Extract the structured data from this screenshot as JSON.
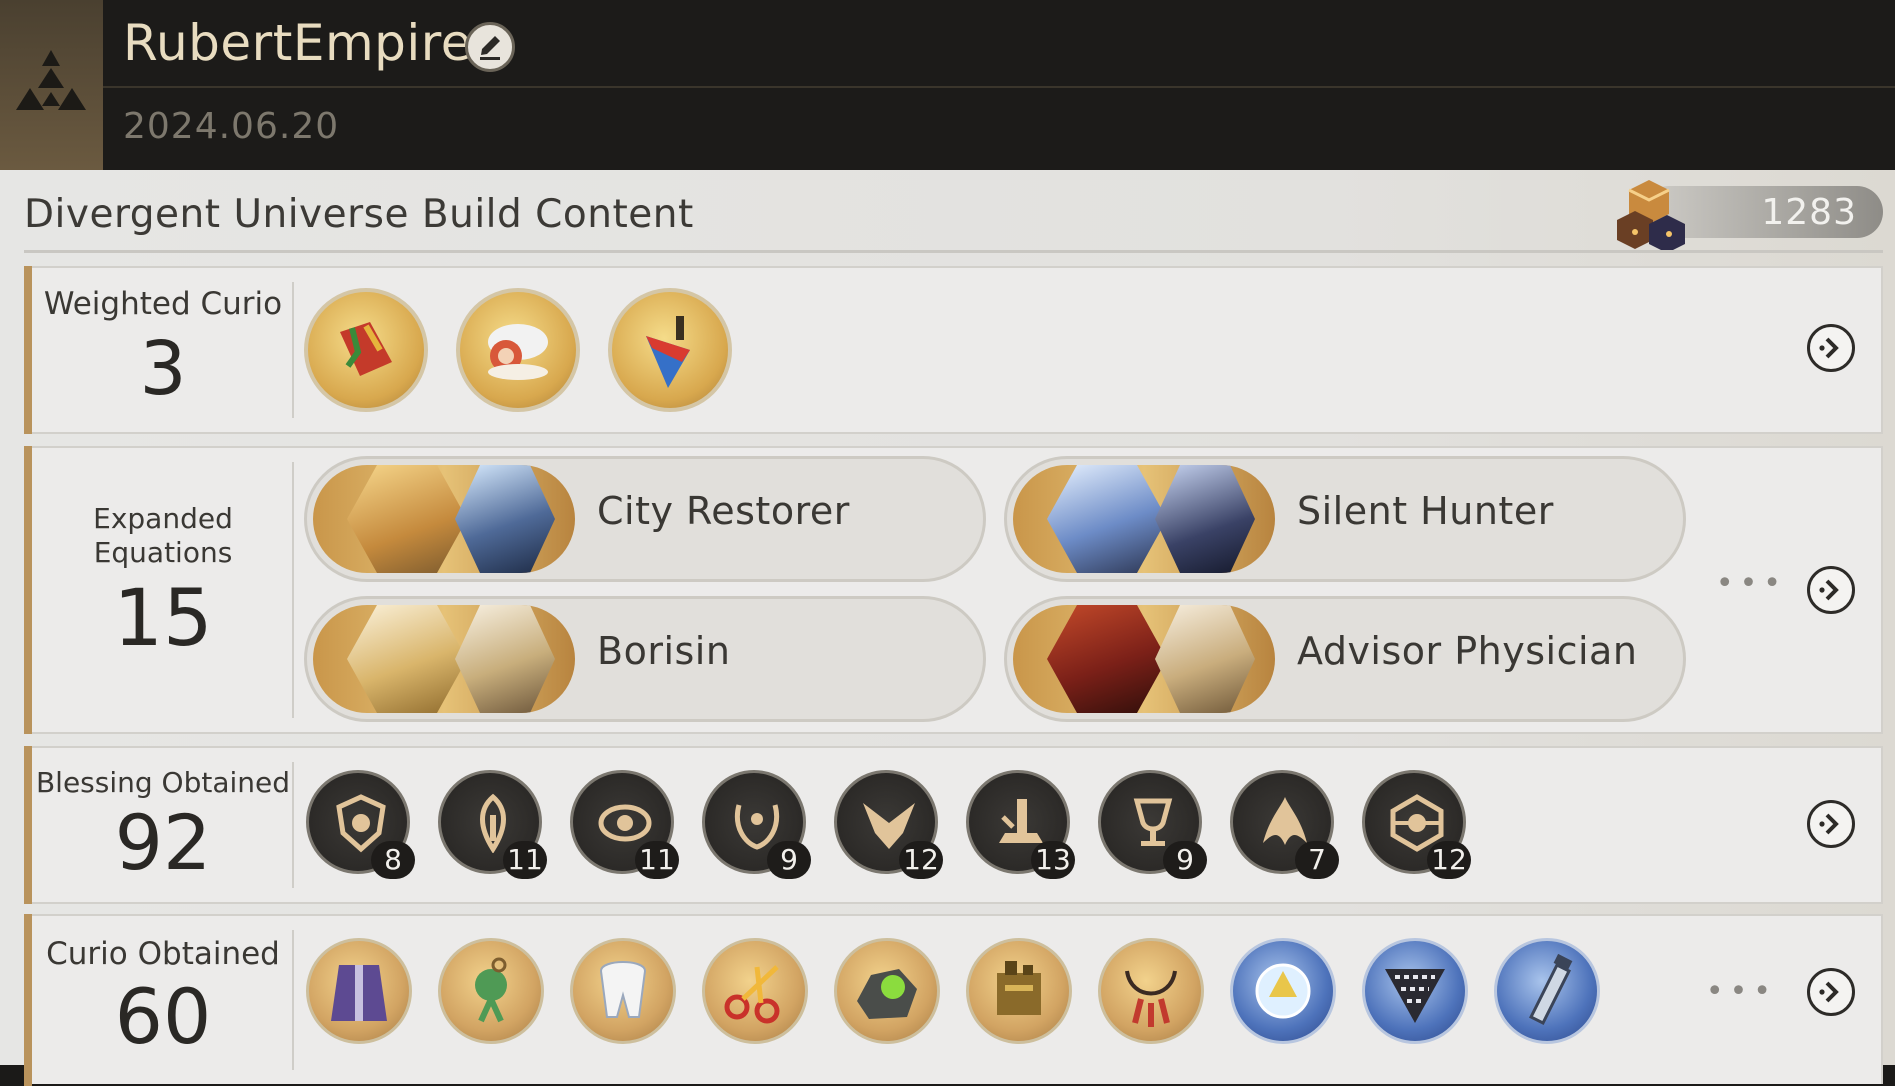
{
  "header": {
    "username": "RubertEmpire",
    "date": "2024.06.20"
  },
  "main": {
    "title": "Divergent Universe Build Content",
    "currency_value": "1283"
  },
  "weighted_curio": {
    "label": "Weighted Curio",
    "count": "3",
    "icons": [
      "folder-curio-icon",
      "dumpling-curio-icon",
      "brush-curio-icon"
    ]
  },
  "expanded_equations": {
    "label_line1": "Expanded",
    "label_line2": "Equations",
    "count": "15",
    "items": [
      {
        "name": "City Restorer"
      },
      {
        "name": "Silent Hunter"
      },
      {
        "name": "Borisin"
      },
      {
        "name": "Advisor Physician"
      }
    ]
  },
  "blessing_obtained": {
    "label": "Blessing Obtained",
    "count": "92",
    "items": [
      {
        "icon": "preservation-path-icon",
        "count": "8"
      },
      {
        "icon": "remembrance-path-icon",
        "count": "11"
      },
      {
        "icon": "nihility-path-icon",
        "count": "11"
      },
      {
        "icon": "abundance-path-icon",
        "count": "9"
      },
      {
        "icon": "hunt-path-icon",
        "count": "12"
      },
      {
        "icon": "destruction-path-icon",
        "count": "13"
      },
      {
        "icon": "elation-path-icon",
        "count": "9"
      },
      {
        "icon": "propagation-path-icon",
        "count": "7"
      },
      {
        "icon": "erudition-path-icon",
        "count": "12"
      }
    ]
  },
  "curio_obtained": {
    "label": "Curio Obtained",
    "count": "60",
    "icons": [
      "cape-curio-icon",
      "knot-curio-icon",
      "tooth-curio-icon",
      "scissors-curio-icon",
      "rock-curio-icon",
      "machine-curio-icon",
      "necklace-curio-icon",
      "crystal-curio-icon",
      "triangle-curio-icon",
      "tube-curio-icon"
    ]
  },
  "colors": {
    "accent_gold": "#b9935c",
    "header_bg": "#1c1b19",
    "panel_bg": "#ecebea"
  }
}
